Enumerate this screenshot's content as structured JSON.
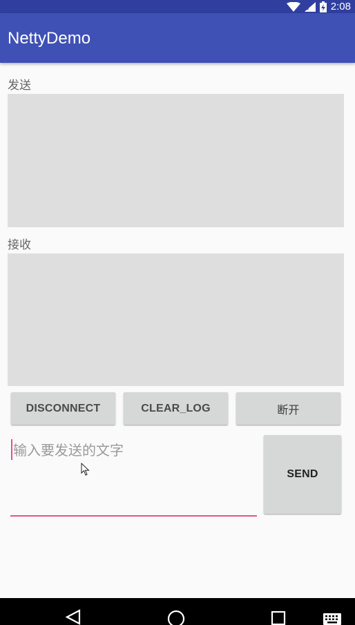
{
  "status_bar": {
    "time": "2:08"
  },
  "app_bar": {
    "title": "NettyDemo"
  },
  "send_section": {
    "label": "发送"
  },
  "receive_section": {
    "label": "接收"
  },
  "buttons": {
    "disconnect": "DISCONNECT",
    "clear_log": "CLEAR_LOG",
    "disconnect_cn": "断开",
    "send": "SEND"
  },
  "message_input": {
    "placeholder": "输入要发送的文字",
    "value": ""
  },
  "colors": {
    "status_bar": "#303f9f",
    "app_bar": "#3f51b5",
    "accent": "#e94f8a",
    "log_box": "#dfdedf",
    "button": "#d6d7d7"
  }
}
